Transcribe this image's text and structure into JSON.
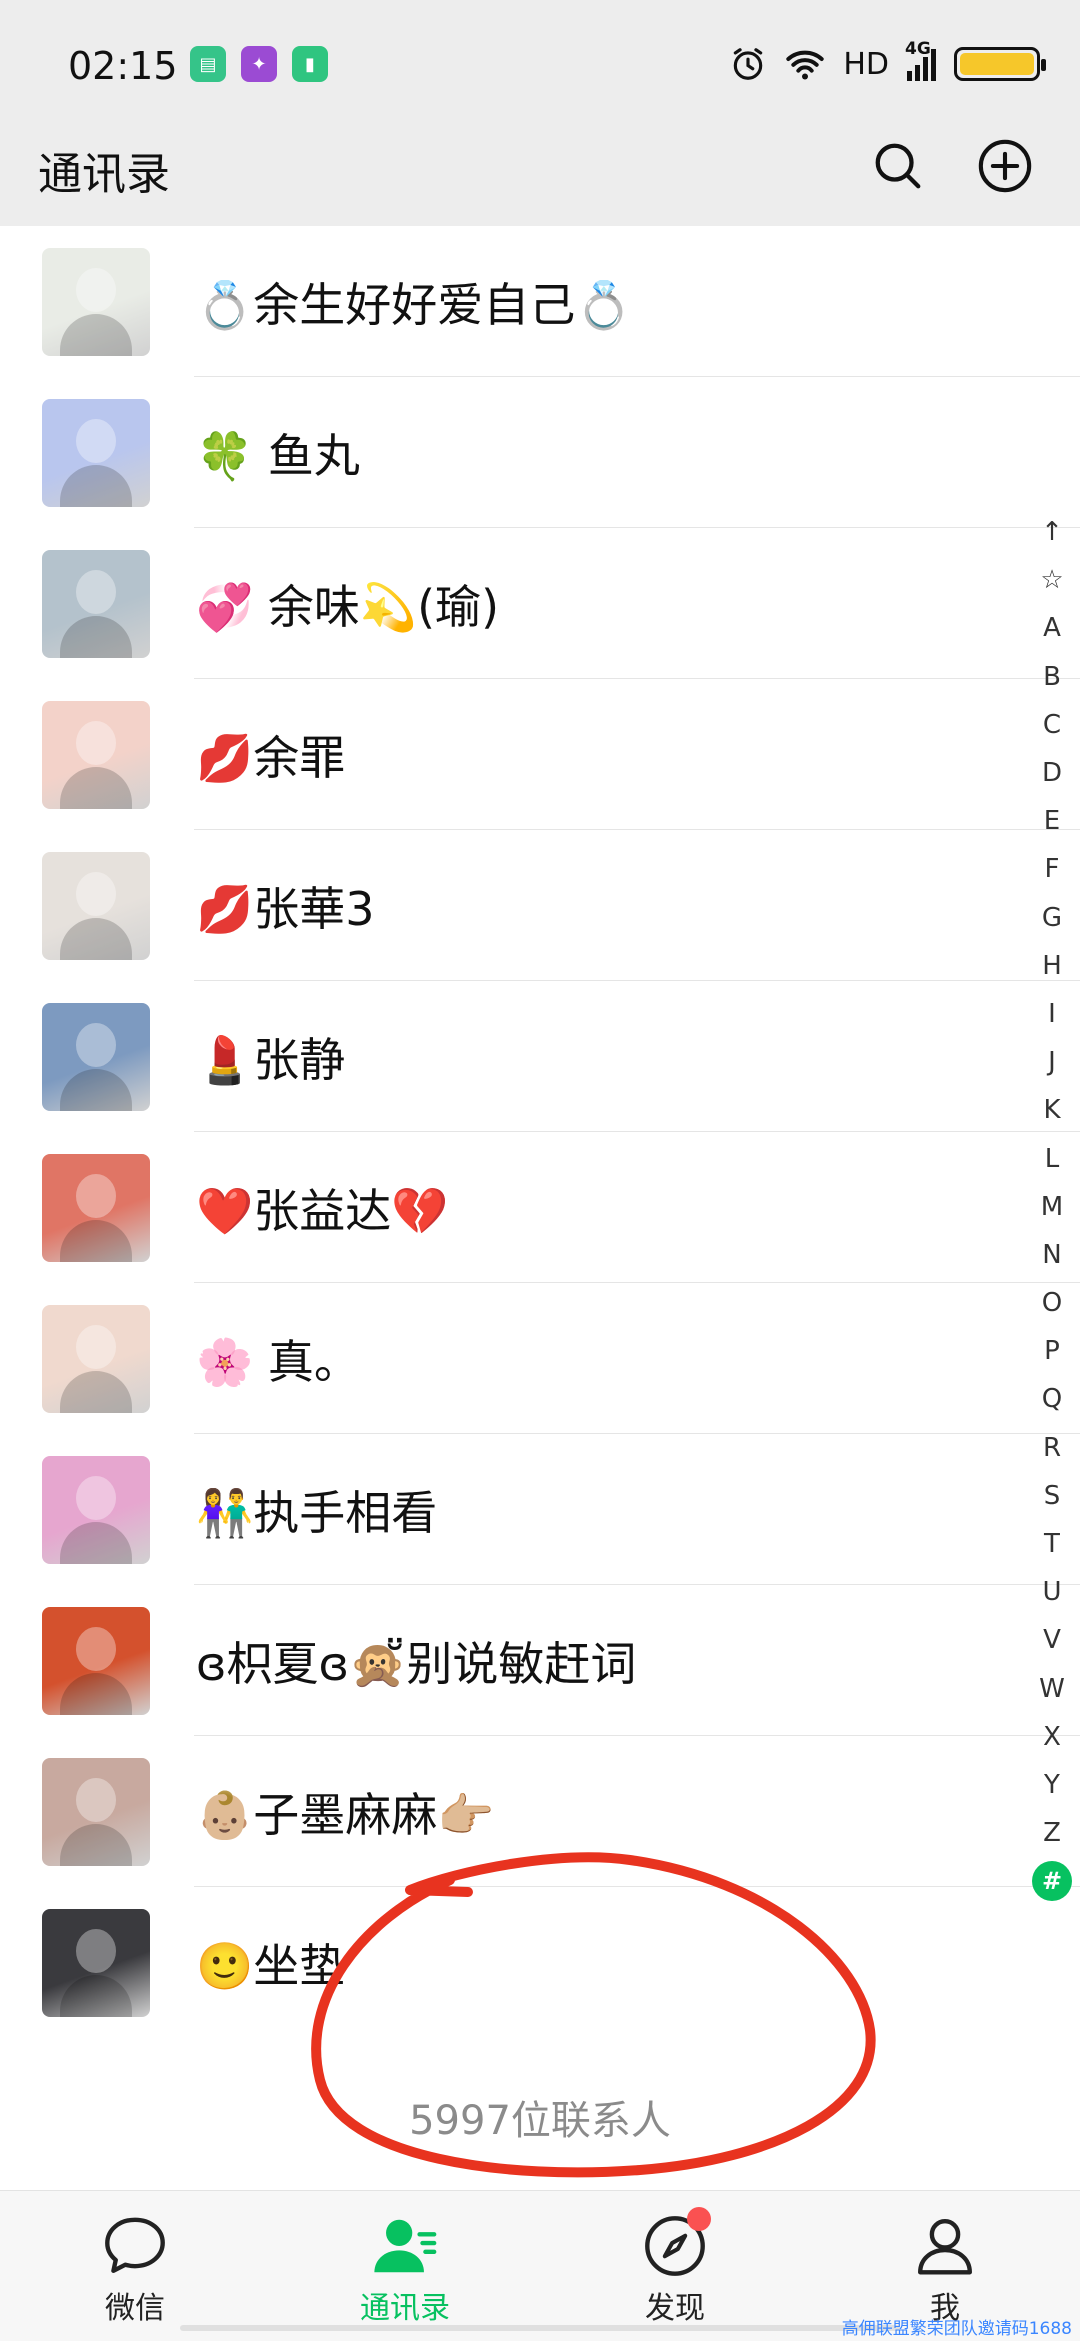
{
  "status_bar": {
    "time": "02:15",
    "network_label": "HD",
    "signal_label": "4G",
    "icons": [
      "alarm-icon",
      "wifi-icon",
      "signal-icon",
      "battery-icon"
    ],
    "app_icon_colors": [
      "#35c489",
      "#9b4bd3",
      "#2fc580"
    ]
  },
  "header": {
    "title": "通讯录",
    "icons": [
      "search-icon",
      "add-icon"
    ]
  },
  "contacts": [
    {
      "name": "💍余生好好爱自己💍",
      "avatar_color": "#e9ece6"
    },
    {
      "name": "🍀 鱼丸",
      "avatar_color": "#b9c6ee"
    },
    {
      "name": "💞 余味💫(瑜)",
      "avatar_color": "#b4c2cc"
    },
    {
      "name": "💋余罪",
      "avatar_color": "#f3d2c9"
    },
    {
      "name": "💋张華3",
      "avatar_color": "#e6e1dc"
    },
    {
      "name": "💄张静",
      "avatar_color": "#7d9ac0"
    },
    {
      "name": "❤️张益达💔",
      "avatar_color": "#e07565"
    },
    {
      "name": "🌸 真。",
      "avatar_color": "#f0d9ce"
    },
    {
      "name": "👫执手相看",
      "avatar_color": "#e6a6cf"
    },
    {
      "name": "ɞ枳夏ɞ🙊̆̈别说敏赶词",
      "avatar_color": "#d4512d"
    },
    {
      "name": "👶🏼子墨麻麻👉🏼",
      "avatar_color": "#c8a99f"
    },
    {
      "name": "🙂坐垫",
      "avatar_color": "#3a3a3e"
    }
  ],
  "index_bar": [
    "↑",
    "☆",
    "A",
    "B",
    "C",
    "D",
    "E",
    "F",
    "G",
    "H",
    "I",
    "J",
    "K",
    "L",
    "M",
    "N",
    "O",
    "P",
    "Q",
    "R",
    "S",
    "T",
    "U",
    "V",
    "W",
    "X",
    "Y",
    "Z",
    "#"
  ],
  "contact_count": "5997位联系人",
  "tabs": [
    {
      "label": "微信",
      "icon": "chat-icon"
    },
    {
      "label": "通讯录",
      "icon": "contacts-icon",
      "active": true
    },
    {
      "label": "发现",
      "icon": "compass-icon",
      "badge": true
    },
    {
      "label": "我",
      "icon": "person-icon"
    }
  ],
  "watermark": "高佣联盟繁荣团队邀请码1688",
  "colors": {
    "accent": "#07c160",
    "badge": "#fa5151",
    "annotation": "#e8331f",
    "header_bg": "#ededed"
  }
}
